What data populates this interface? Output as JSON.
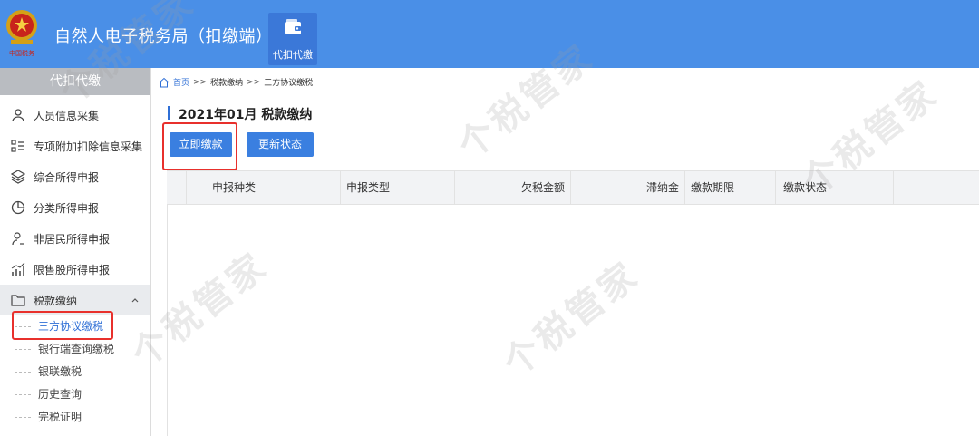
{
  "header": {
    "title": "自然人电子税务局（扣缴端）",
    "emblem_caption": "中国税务",
    "module_tab": {
      "label": "代扣代缴",
      "icon": "wallet-icon"
    }
  },
  "sidebar": {
    "header": "代扣代缴",
    "items": [
      {
        "label": "人员信息采集",
        "icon": "person-icon"
      },
      {
        "label": "专项附加扣除信息采集",
        "icon": "list-icon"
      },
      {
        "label": "综合所得申报",
        "icon": "layers-icon"
      },
      {
        "label": "分类所得申报",
        "icon": "pie-icon"
      },
      {
        "label": "非居民所得申报",
        "icon": "person-outline-icon"
      },
      {
        "label": "限售股所得申报",
        "icon": "bar-chart-icon"
      },
      {
        "label": "税款缴纳",
        "icon": "folder-icon",
        "expanded": true
      }
    ],
    "sub_items": [
      {
        "label": "三方协议缴税",
        "selected": true
      },
      {
        "label": "银行端查询缴税"
      },
      {
        "label": "银联缴税"
      },
      {
        "label": "历史查询"
      },
      {
        "label": "完税证明"
      }
    ]
  },
  "breadcrumb": {
    "home": "首页",
    "sep": ">>",
    "level1": "税款缴纳",
    "level2": "三方协议缴税"
  },
  "main": {
    "title": "2021年01月  税款缴纳",
    "pay_button": "立即缴款",
    "refresh_button": "更新状态",
    "columns": [
      "申报种类",
      "申报类型",
      "欠税金额",
      "滞纳金",
      "缴款期限",
      "缴款状态"
    ]
  },
  "watermark": "个税管家",
  "colors": {
    "header_bg": "#4a8fe7",
    "button": "#3a7fe0",
    "highlight": "#e8302c",
    "link": "#2f6fd6"
  }
}
